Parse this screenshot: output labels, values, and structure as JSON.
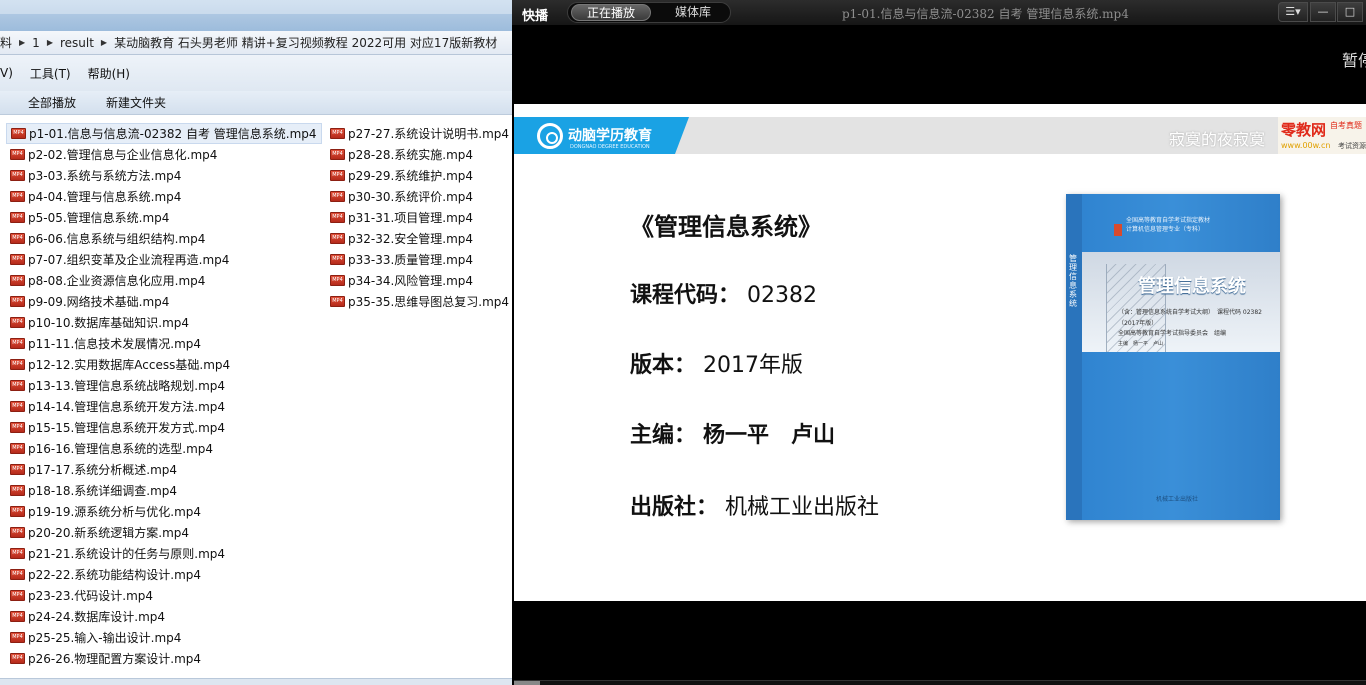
{
  "explorer": {
    "address": [
      "料",
      "1",
      "result",
      "某动脑教育 石头男老师 精讲+复习视频教程 2022可用 对应17版新教材"
    ],
    "menu": [
      "V)",
      "工具(T)",
      "帮助(H)"
    ],
    "toolbar": [
      "全部播放",
      "新建文件夹"
    ],
    "file_icon_text": "MP4",
    "files_col1": [
      "p1-01.信息与信息流-02382 自考 管理信息系统.mp4",
      "p2-02.管理信息与企业信息化.mp4",
      "p3-03.系统与系统方法.mp4",
      "p4-04.管理与信息系统.mp4",
      "p5-05.管理信息系统.mp4",
      "p6-06.信息系统与组织结构.mp4",
      "p7-07.组织变革及企业流程再造.mp4",
      "p8-08.企业资源信息化应用.mp4",
      "p9-09.网络技术基础.mp4",
      "p10-10.数据库基础知识.mp4",
      "p11-11.信息技术发展情况.mp4",
      "p12-12.实用数据库Access基础.mp4",
      "p13-13.管理信息系统战略规划.mp4",
      "p14-14.管理信息系统开发方法.mp4",
      "p15-15.管理信息系统开发方式.mp4",
      "p16-16.管理信息系统的选型.mp4",
      "p17-17.系统分析概述.mp4",
      "p18-18.系统详细调查.mp4",
      "p19-19.源系统分析与优化.mp4",
      "p20-20.新系统逻辑方案.mp4",
      "p21-21.系统设计的任务与原则.mp4",
      "p22-22.系统功能结构设计.mp4",
      "p23-23.代码设计.mp4",
      "p24-24.数据库设计.mp4",
      "p25-25.输入-输出设计.mp4",
      "p26-26.物理配置方案设计.mp4"
    ],
    "files_col2": [
      "p27-27.系统设计说明书.mp4",
      "p28-28.系统实施.mp4",
      "p29-29.系统维护.mp4",
      "p30-30.系统评价.mp4",
      "p31-31.项目管理.mp4",
      "p32-32.安全管理.mp4",
      "p33-33.质量管理.mp4",
      "p34-34.风险管理.mp4",
      "p35-35.思维导图总复习.mp4"
    ],
    "selected_index": 0
  },
  "player": {
    "brand": "快播",
    "tabs": [
      "正在播放",
      "媒体库"
    ],
    "active_tab": 0,
    "video_title": "p1-01.信息与信息流-02382  自考  管理信息系统.mp4",
    "window_controls": [
      "☰▾",
      "—",
      "□"
    ],
    "pause_hint": "暂停",
    "progress": 0.03
  },
  "slide": {
    "logo_name": "动脑学历教育",
    "logo_sub": "DONGNAO DEGREE EDUCATION",
    "slogan": "寂寞的夜寂寞",
    "watermark_main": "零教网",
    "watermark_sub": "自考真题",
    "watermark_url": "www.00w.cn",
    "watermark_tag": "考试资源",
    "title": "《管理信息系统》",
    "code_label": "课程代码：",
    "code_value": "02382",
    "edition_label": "版本：",
    "edition_value": "2017年版",
    "editor_label": "主编：",
    "editor_value": "杨一平　卢山",
    "publisher_label": "出版社：",
    "publisher_value": "机械工业出版社"
  },
  "book": {
    "header": "全国高等教育自学考试指定教材\n计算机信息管理专业（专科）",
    "title": "管理信息系统",
    "subtitle": "（含：管理信息系统自学考试大纲）　课程代码 02382",
    "year": "（2017年版）",
    "blurb": "全国高等教育自学考试指导委员会　组编",
    "editor": "主编　杨一平　卢山",
    "spine": "管理信息系统",
    "publisher": "机械工业出版社"
  },
  "colors": {
    "logo_blue": "#1aa2e4",
    "book_blue": "#3a8fd8",
    "watermark_red": "#e02a1a",
    "player_bg": "#000000"
  }
}
